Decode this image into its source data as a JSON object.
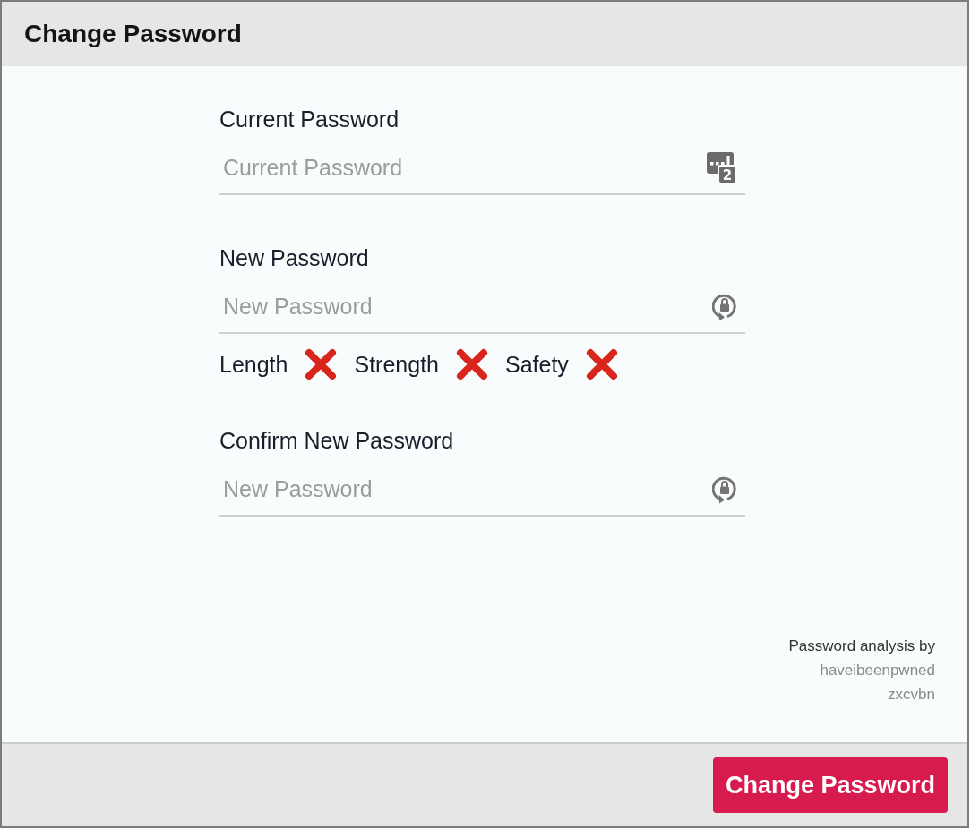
{
  "dialog": {
    "title": "Change Password"
  },
  "fields": [
    {
      "kind": "current",
      "label": "Current Password",
      "placeholder": "Current Password",
      "icon_badge": "2"
    },
    {
      "kind": "new",
      "label": "New Password",
      "placeholder": "New Password",
      "requirements": [
        {
          "label": "Length",
          "passed": false
        },
        {
          "label": "Strength",
          "passed": false
        },
        {
          "label": "Safety",
          "passed": false
        }
      ]
    },
    {
      "kind": "new",
      "label": "Confirm New Password",
      "placeholder": "New Password"
    }
  ],
  "credits": {
    "heading": "Password analysis by",
    "links": [
      "haveibeenpwned",
      "zxcvbn"
    ]
  },
  "submit_button": {
    "label": "Change Password"
  }
}
